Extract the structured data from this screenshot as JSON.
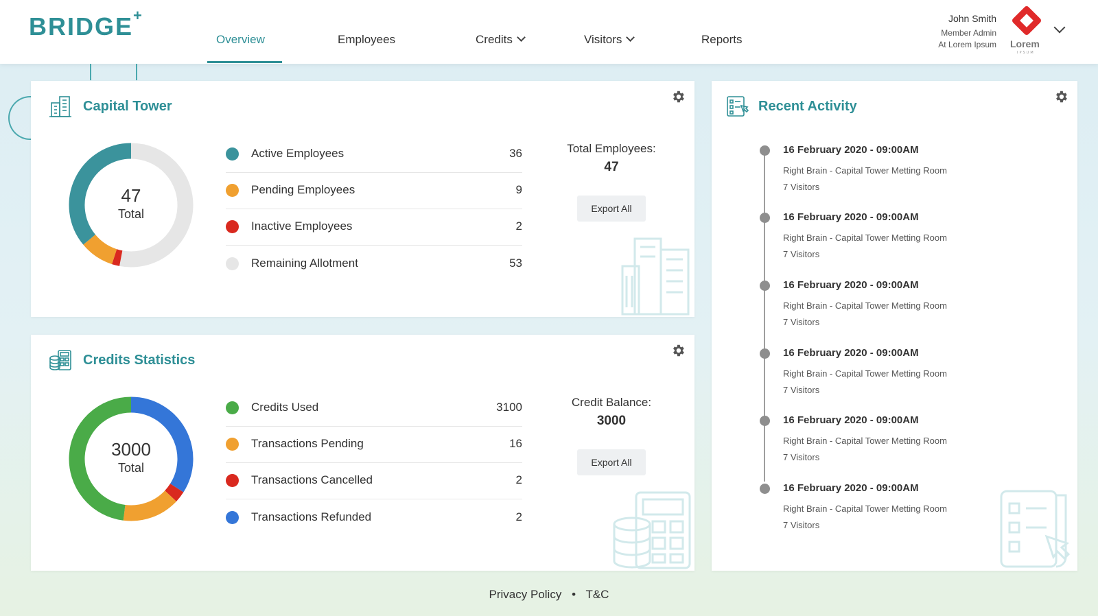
{
  "header": {
    "logo": "BRIDGE",
    "logo_plus": "+",
    "nav": [
      {
        "label": "Overview"
      },
      {
        "label": "Employees"
      },
      {
        "label": "Credits"
      },
      {
        "label": "Visitors"
      },
      {
        "label": "Reports"
      }
    ],
    "user": {
      "name": "John Smith",
      "role": "Member Admin",
      "org": "At Lorem Ipsum",
      "brand": "Lorem",
      "brand_sub": "IPSUM"
    }
  },
  "colors": {
    "accent": "#2e8f96",
    "active": "#3b939c",
    "pending": "#f0a030",
    "inactive": "#d9291f",
    "remaining": "#e6e6e6",
    "used": "#4aab48",
    "refunded": "#3476d8"
  },
  "capital": {
    "title": "Capital Tower",
    "total_num": "47",
    "total_label": "Total",
    "legend": [
      {
        "label": "Active Employees",
        "value": "36"
      },
      {
        "label": "Pending Employees",
        "value": "9"
      },
      {
        "label": "Inactive Employees",
        "value": "2"
      },
      {
        "label": "Remaining Allotment",
        "value": "53"
      }
    ],
    "summary_label": "Total Employees:",
    "summary_value": "47",
    "export_label": "Export All"
  },
  "credits": {
    "title": "Credits Statistics",
    "total_num": "3000",
    "total_label": "Total",
    "legend": [
      {
        "label": "Credits Used",
        "value": "3100"
      },
      {
        "label": "Transactions Pending",
        "value": "16"
      },
      {
        "label": "Transactions Cancelled",
        "value": "2"
      },
      {
        "label": "Transactions Refunded",
        "value": "2"
      }
    ],
    "summary_label": "Credit Balance:",
    "summary_value": "3000",
    "export_label": "Export All"
  },
  "activity": {
    "title": "Recent Activity",
    "items": [
      {
        "date": "16 February 2020 - 09:00AM",
        "place": "Right Brain - Capital Tower Metting Room",
        "visitors": "7 Visitors"
      },
      {
        "date": "16 February 2020 - 09:00AM",
        "place": "Right Brain - Capital Tower Metting Room",
        "visitors": "7 Visitors"
      },
      {
        "date": "16 February 2020 - 09:00AM",
        "place": "Right Brain - Capital Tower Metting Room",
        "visitors": "7 Visitors"
      },
      {
        "date": "16 February 2020 - 09:00AM",
        "place": "Right Brain - Capital Tower Metting Room",
        "visitors": "7 Visitors"
      },
      {
        "date": "16 February 2020 - 09:00AM",
        "place": "Right Brain - Capital Tower Metting Room",
        "visitors": "7 Visitors"
      },
      {
        "date": "16 February 2020 - 09:00AM",
        "place": "Right Brain - Capital Tower Metting Room",
        "visitors": "7 Visitors"
      }
    ]
  },
  "footer": {
    "privacy": "Privacy Policy",
    "separator": "•",
    "tc": "T&C"
  }
}
